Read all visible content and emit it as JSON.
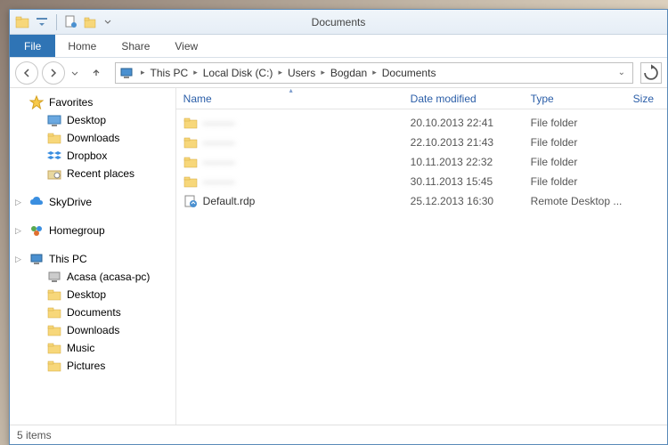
{
  "window": {
    "title": "Documents"
  },
  "ribbon": {
    "file": "File",
    "tabs": [
      "Home",
      "Share",
      "View"
    ]
  },
  "breadcrumb": [
    "This PC",
    "Local Disk (C:)",
    "Users",
    "Bogdan",
    "Documents"
  ],
  "columns": {
    "name": "Name",
    "date": "Date modified",
    "type": "Type",
    "size": "Size"
  },
  "sidebar": {
    "favorites": {
      "label": "Favorites",
      "items": [
        "Desktop",
        "Downloads",
        "Dropbox",
        "Recent places"
      ]
    },
    "skydrive": {
      "label": "SkyDrive"
    },
    "homegroup": {
      "label": "Homegroup"
    },
    "thispc": {
      "label": "This PC",
      "items": [
        "Acasa (acasa-pc)",
        "Desktop",
        "Documents",
        "Downloads",
        "Music",
        "Pictures"
      ]
    }
  },
  "files": [
    {
      "name": "———",
      "date": "20.10.2013 22:41",
      "type": "File folder",
      "blurred": true,
      "kind": "folder"
    },
    {
      "name": "———",
      "date": "22.10.2013 21:43",
      "type": "File folder",
      "blurred": true,
      "kind": "folder"
    },
    {
      "name": "———",
      "date": "10.11.2013 22:32",
      "type": "File folder",
      "blurred": true,
      "kind": "folder"
    },
    {
      "name": "———",
      "date": "30.11.2013 15:45",
      "type": "File folder",
      "blurred": true,
      "kind": "folder"
    },
    {
      "name": "Default.rdp",
      "date": "25.12.2013 16:30",
      "type": "Remote Desktop ...",
      "blurred": false,
      "kind": "rdp"
    }
  ],
  "status": {
    "text": "5 items"
  }
}
